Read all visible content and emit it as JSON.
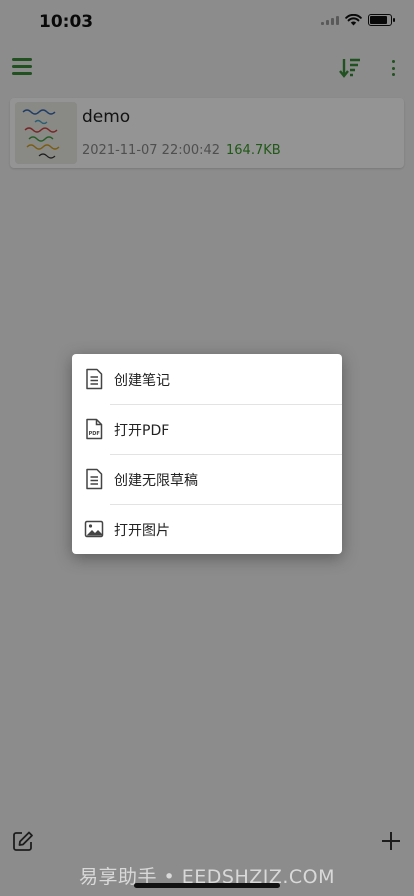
{
  "status_bar": {
    "time": "10:03"
  },
  "toolbar": {
    "menu_icon": "hamburger-menu-icon",
    "sort_icon": "sort-descending-icon",
    "more_icon": "more-vertical-icon",
    "accent_color": "#3a8a3a"
  },
  "notes": [
    {
      "title": "demo",
      "date": "2021-11-07 22:00:42",
      "size": "164.7KB",
      "size_color": "#3a9a2a"
    }
  ],
  "popup_menu": {
    "items": [
      {
        "label": "创建笔记",
        "icon": "document-icon"
      },
      {
        "label": "打开PDF",
        "icon": "pdf-file-icon"
      },
      {
        "label": "创建无限草稿",
        "icon": "document-icon"
      },
      {
        "label": "打开图片",
        "icon": "image-icon"
      }
    ]
  },
  "bottom_bar": {
    "compose_icon": "compose-icon",
    "add_icon": "plus-icon"
  },
  "watermark": "易享助手 • EEDSHZJZ.COM"
}
